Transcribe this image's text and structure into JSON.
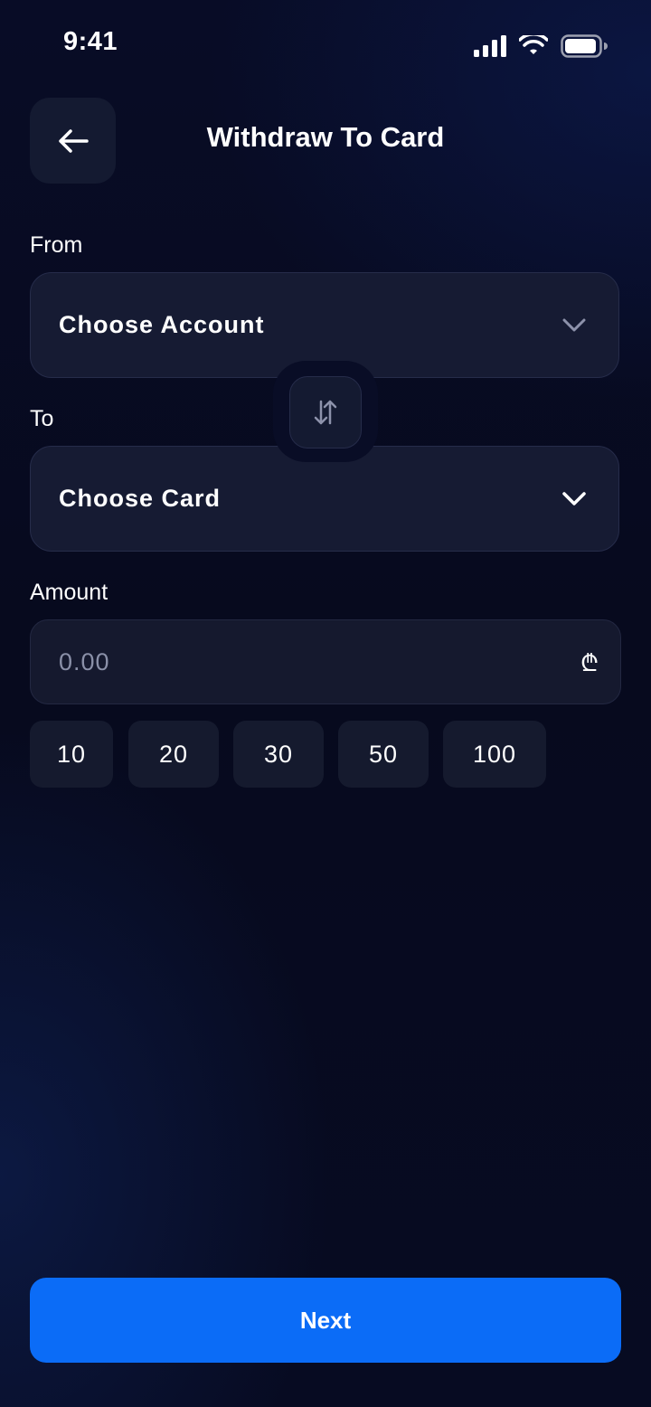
{
  "status_bar": {
    "time": "9:41"
  },
  "header": {
    "title": "Withdraw To Card"
  },
  "from": {
    "label": "From",
    "value": "Choose Account"
  },
  "to": {
    "label": "To",
    "value": "Choose Card"
  },
  "amount": {
    "label": "Amount",
    "placeholder": "0.00",
    "currency_symbol": "₾"
  },
  "quick_amounts": [
    "10",
    "20",
    "30",
    "50",
    "100"
  ],
  "actions": {
    "next_label": "Next"
  },
  "colors": {
    "accent": "#0b6cf7",
    "background": "#070a1e",
    "field": "#161b33"
  }
}
